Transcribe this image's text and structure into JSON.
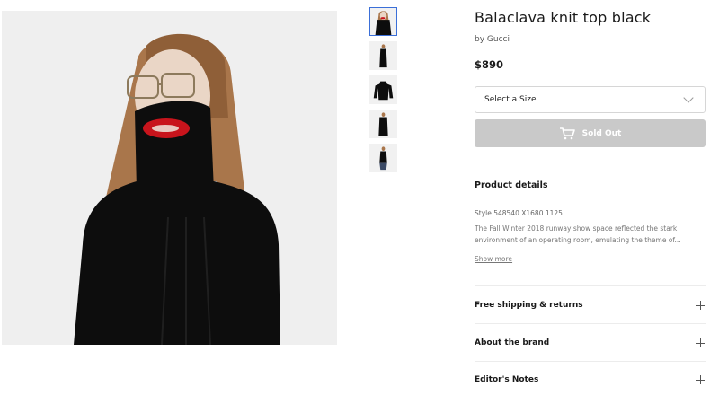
{
  "product": {
    "title": "Balaclava knit top black",
    "brand": "by Gucci",
    "price": "$890"
  },
  "size_select": {
    "label": "Select a Size"
  },
  "sold_out": {
    "label": "Sold Out",
    "icon": "cart-icon"
  },
  "details": {
    "heading": "Product details",
    "style": "Style 548540 X1680 1125",
    "description": "The Fall Winter 2018 runway show space reflected the stark environment of an operating room, emulating the theme of...",
    "show_more": "Show more"
  },
  "accordion": [
    {
      "label": "Free shipping & returns",
      "icon": "plus-icon"
    },
    {
      "label": "About the brand",
      "icon": "plus-icon"
    },
    {
      "label": "Editor's Notes",
      "icon": "plus-icon"
    }
  ],
  "thumbnails": [
    {
      "view": "portrait",
      "selected": true
    },
    {
      "view": "full-length-front",
      "selected": false
    },
    {
      "view": "flat-lay",
      "selected": false
    },
    {
      "view": "full-length-side",
      "selected": false
    },
    {
      "view": "full-length-back",
      "selected": false
    }
  ],
  "colors": {
    "sold_out_bg": "#c9c9c9",
    "thumb_selected_border": "#3b6fd8",
    "garment": "#0d0d0d",
    "lips": "#c8141c"
  }
}
